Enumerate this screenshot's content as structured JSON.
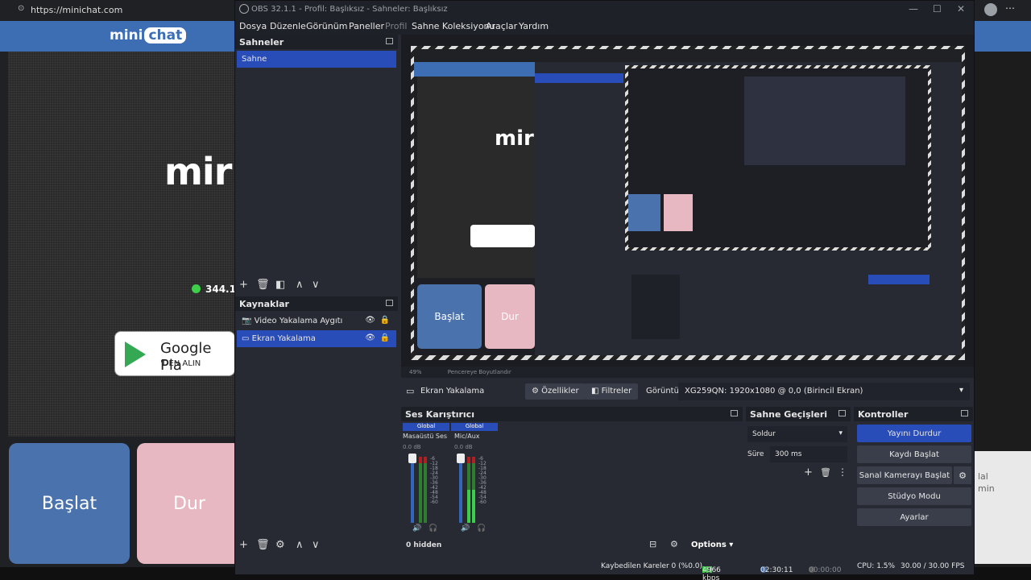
{
  "browser": {
    "url": "https://minichat.com",
    "logo_text": "mini",
    "logo_chat": "chat",
    "cam_text": "mir",
    "online_count": "344.1",
    "gplay_line1": "Google Pla",
    "gplay_line2": "'DEN ALIN",
    "start_label": "Başlat",
    "stop_label": "Dur",
    "right_text": "lal\nmin"
  },
  "obs": {
    "window_title": "OBS 32.1.1 - Profil: Başlıksız - Sahneler: Başlıksız",
    "menu": [
      "Dosya",
      "Düzenle",
      "Görünüm",
      "Paneller",
      "Profil",
      "Sahne Koleksiyonu",
      "Araçlar",
      "Yardım"
    ],
    "scenes": {
      "title": "Sahneler",
      "items": [
        "Sahne"
      ]
    },
    "sources": {
      "title": "Kaynaklar",
      "items": [
        {
          "label": "Video Yakalama Aygıtı",
          "icon": "camera-icon"
        },
        {
          "label": "Ekran Yakalama",
          "icon": "monitor-icon"
        }
      ]
    },
    "preview": {
      "zoom": "49%",
      "fit_label": "Pencereye Boyutlandır"
    },
    "properties_bar": {
      "source": "Ekran Yakalama",
      "properties": "Özellikler",
      "filters": "Filtreler",
      "display_label": "Görüntü",
      "display_value": "XG259QN: 1920x1080 @ 0,0 (Birincil Ekran)"
    },
    "mixer": {
      "title": "Ses Karıştırıcı",
      "channels": [
        {
          "tag": "Global",
          "name": "Masaüstü Ses",
          "db": "0.0 dB"
        },
        {
          "tag": "Global",
          "name": "Mic/Aux",
          "db": "0.0 dB"
        }
      ],
      "scale": [
        "-6",
        "-12",
        "-18",
        "-24",
        "-30",
        "-36",
        "-42",
        "-48",
        "-54",
        "-60"
      ],
      "hidden": "0 hidden",
      "options": "Options"
    },
    "transitions": {
      "title": "Sahne Geçişleri",
      "type": "Soldur",
      "duration_label": "Süre",
      "duration_value": "300 ms"
    },
    "controls": {
      "title": "Kontroller",
      "buttons": [
        "Yayını Durdur",
        "Kaydı Başlat",
        "Sanal Kamerayı Başlat",
        "Stüdyo Modu",
        "Ayarlar"
      ]
    },
    "status": {
      "dropped": "Kaybedilen Kareler 0 (%0.0)",
      "bitrate": "4966 kbps",
      "stream_time": "02:30:11",
      "rec_time": "00:00:00",
      "cpu": "CPU: 1.5%",
      "fps": "30.00 / 30.00 FPS"
    }
  }
}
